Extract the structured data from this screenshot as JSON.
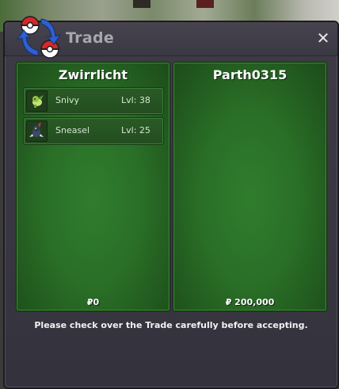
{
  "window": {
    "title": "Trade",
    "close_label": "✕",
    "footer_message": "Please check over the Trade carefully before accepting."
  },
  "left_panel": {
    "trainer": "Zwirrlicht",
    "money": "₽0",
    "pokemon": [
      {
        "name": "Snivy",
        "level": "Lvl: 38",
        "icon": "snivy-sprite-icon"
      },
      {
        "name": "Sneasel",
        "level": "Lvl: 25",
        "icon": "sneasel-sprite-icon"
      }
    ]
  },
  "right_panel": {
    "trainer": "Parth0315",
    "money": "₽ 200,000",
    "pokemon": []
  },
  "colors": {
    "panel_green": "#2a6f27",
    "window_bg": "#3a3842",
    "title_text": "#a7a6ad",
    "text_white": "#ffffff"
  },
  "icons": {
    "trade": "trade-arrows-pokeball-icon",
    "close": "close-icon"
  }
}
